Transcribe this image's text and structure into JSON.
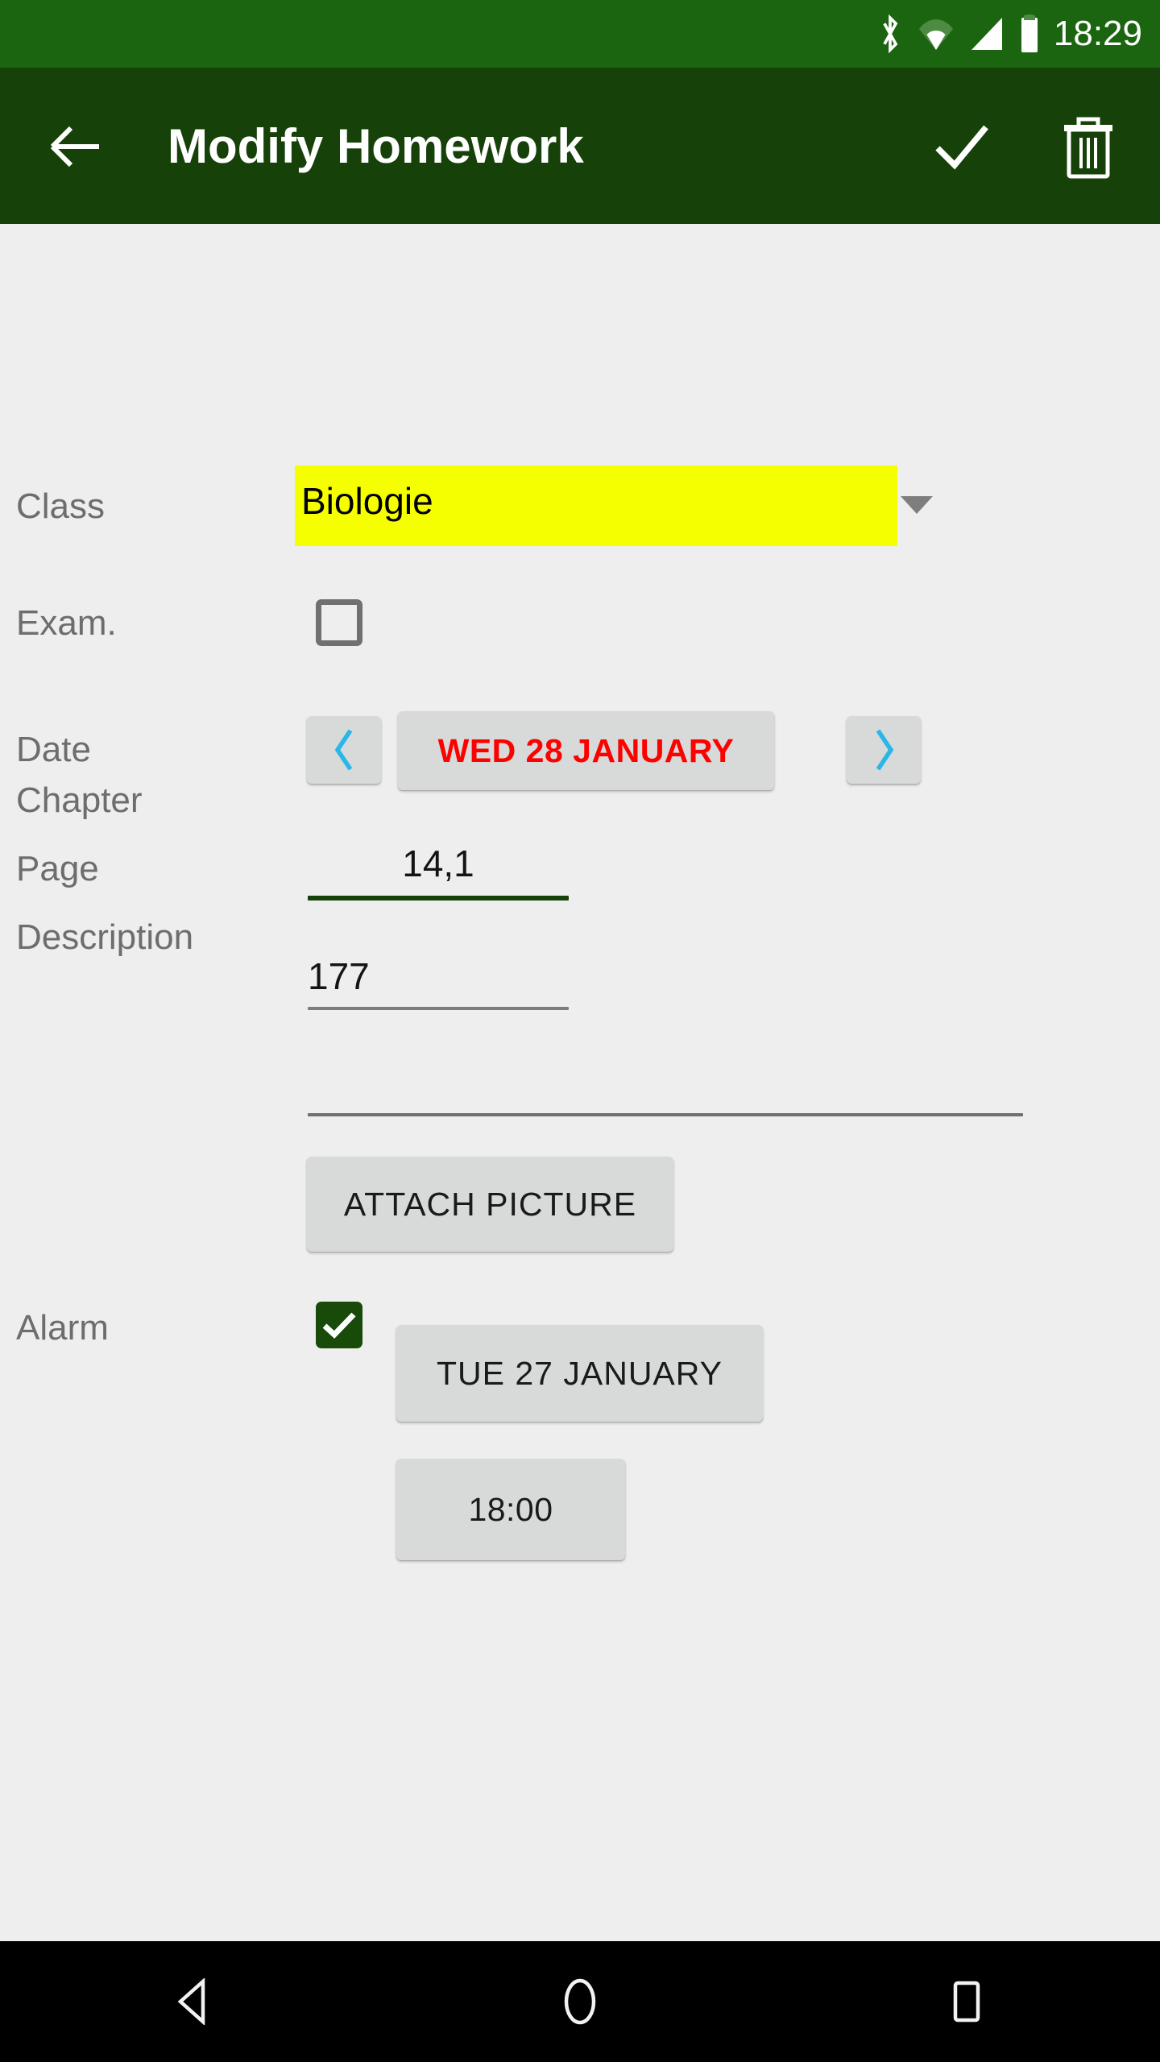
{
  "status_bar": {
    "time": "18:29",
    "icons": [
      "bluetooth-icon",
      "wifi-icon",
      "signal-icon",
      "battery-icon"
    ],
    "background_color": "#1B6510"
  },
  "app_bar": {
    "title": "Modify Homework",
    "back_label": "back-arrow",
    "save_label": "save-check",
    "delete_label": "delete-trash",
    "background_color": "#164209",
    "title_color": "#FFFFFF"
  },
  "form": {
    "class": {
      "label": "Class",
      "value": "Biologie",
      "highlight_color": "#F6FF00",
      "dropdown_icon": "chevron-down-icon"
    },
    "exam": {
      "label": "Exam.",
      "checked": false
    },
    "date": {
      "label": "Date",
      "value": "WED 28 JANUARY",
      "value_color": "#FF0000",
      "prev_icon": "chevron-left-icon",
      "next_icon": "chevron-right-icon",
      "arrow_color": "#29B6E8"
    },
    "chapter": {
      "label": "Chapter",
      "value": "14,1",
      "placeholder": "",
      "focused": true,
      "underline_color": "#164209"
    },
    "page": {
      "label": "Page",
      "value": "177",
      "placeholder": "",
      "focused": false,
      "underline_color": "#7D7D7D"
    },
    "description": {
      "label": "Description",
      "value": "",
      "placeholder": "",
      "focused": false,
      "underline_color": "#6F6F6F"
    },
    "attach_picture": {
      "label": "ATTACH PICTURE"
    },
    "alarm": {
      "label": "Alarm",
      "checked": true,
      "check_color": "#184B09",
      "date_value": "TUE 27 JANUARY",
      "time_value": "18:00"
    }
  },
  "nav_bar": {
    "back_label": "nav-back-triangle",
    "home_label": "nav-home-circle",
    "recents_label": "nav-recents-square",
    "background_color": "#000000"
  }
}
